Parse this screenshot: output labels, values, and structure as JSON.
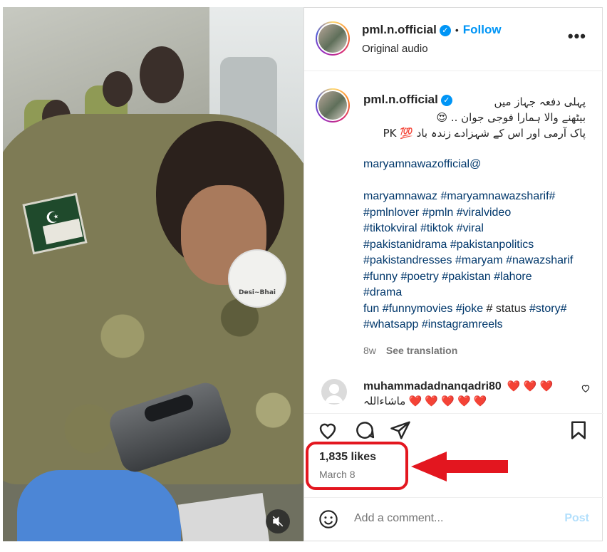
{
  "post": {
    "username": "pml.n.official",
    "follow_label": "Follow",
    "separator": "•",
    "audio": "Original audio",
    "more_label": "•••"
  },
  "caption": {
    "username": "pml.n.official",
    "urdu_line1": "پہلی دفعہ جہاز میں",
    "urdu_line2": "بیٹھنے والا ہمارا فوجی جوان .. 😍",
    "urdu_line3": "پاک آرمی اور اس کے شہزادے زندہ باد 💯 PK",
    "mention": "maryamnawazofficial@",
    "hashtags_lines": [
      [
        {
          "t": "maryamnawaz",
          "tag": true
        },
        {
          "t": " ",
          "tag": false
        },
        {
          "t": "#maryamnawazsharif#",
          "tag": true
        }
      ],
      [
        {
          "t": "#pmlnlover #pmln #viralvideo",
          "tag": true
        }
      ],
      [
        {
          "t": "#tiktokviral #tiktok #viral",
          "tag": true
        }
      ],
      [
        {
          "t": "#pakistanidrama #pakistanpolitics",
          "tag": true
        }
      ],
      [
        {
          "t": "#pakistandresses #maryam #nawazsharif",
          "tag": true
        }
      ],
      [
        {
          "t": "#funny #poetry #pakistan #lahore",
          "tag": true
        }
      ],
      [
        {
          "t": "#drama",
          "tag": true
        }
      ],
      [
        {
          "t": "fun #funnymovies #joke",
          "tag": true
        },
        {
          "t": " # status ",
          "tag": false
        },
        {
          "t": "#story#",
          "tag": true
        }
      ],
      [
        {
          "t": "#whatsapp #instagramreels",
          "tag": true
        }
      ]
    ],
    "age": "8w",
    "translation": "See translation"
  },
  "comment": {
    "username": "muhammadadnanqadri80",
    "hearts": "❤️ ❤️ ❤️",
    "text": "ماشاءاللہ ❤️ ❤️ ❤️ ❤️ ❤️"
  },
  "stats": {
    "likes": "1,835 likes",
    "date": "March 8"
  },
  "composer": {
    "placeholder": "Add a comment...",
    "post_label": "Post"
  },
  "media": {
    "watermark": "Desi~Bhai"
  },
  "colors": {
    "accent": "#0095f6",
    "link": "#00376b",
    "highlight": "#e3161f"
  }
}
